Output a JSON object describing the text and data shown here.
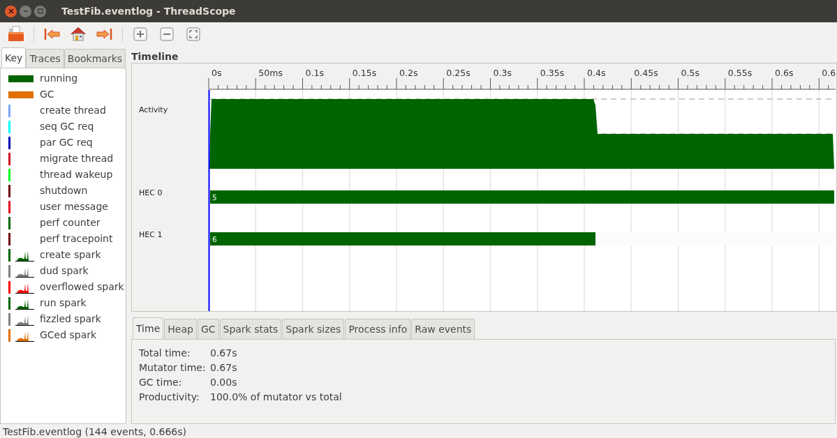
{
  "window": {
    "title": "TestFib.eventlog - ThreadScope"
  },
  "toolbar": [
    {
      "kind": "open"
    },
    {
      "kind": "first"
    },
    {
      "kind": "home"
    },
    {
      "kind": "last"
    },
    {
      "kind": "sep"
    },
    {
      "kind": "zoom-in"
    },
    {
      "kind": "zoom-out"
    },
    {
      "kind": "zoom-fit"
    }
  ],
  "side_tabs": [
    {
      "label": "Key",
      "selected": true
    },
    {
      "label": "Traces",
      "selected": false
    },
    {
      "label": "Bookmarks",
      "selected": false
    }
  ],
  "key": [
    {
      "label": "running",
      "kind": "bar",
      "color": "#006400"
    },
    {
      "label": "GC",
      "kind": "bar",
      "color": "#e07000"
    },
    {
      "label": "create thread",
      "kind": "line",
      "color": "#7aa7ff"
    },
    {
      "label": "seq GC req",
      "kind": "line",
      "color": "#00ffff"
    },
    {
      "label": "par GC req",
      "kind": "line",
      "color": "#0000b0"
    },
    {
      "label": "migrate thread",
      "kind": "line",
      "color": "#d0101c"
    },
    {
      "label": "thread wakeup",
      "kind": "line",
      "color": "#00ff20"
    },
    {
      "label": "shutdown",
      "kind": "line",
      "color": "#700010"
    },
    {
      "label": "user message",
      "kind": "line",
      "color": "#e01020"
    },
    {
      "label": "perf counter",
      "kind": "line",
      "color": "#006400"
    },
    {
      "label": "perf tracepoint",
      "kind": "line",
      "color": "#700010"
    },
    {
      "label": "create spark",
      "kind": "spark",
      "color": "#006400"
    },
    {
      "label": "dud spark",
      "kind": "spark",
      "color": "#808080"
    },
    {
      "label": "overflowed spark",
      "kind": "spark",
      "color": "#ff0000"
    },
    {
      "label": "run spark",
      "kind": "spark",
      "color": "#006400"
    },
    {
      "label": "fizzled spark",
      "kind": "spark",
      "color": "#808080"
    },
    {
      "label": "GCed spark",
      "kind": "spark",
      "color": "#e07000"
    }
  ],
  "timeline": {
    "title": "Timeline",
    "ticks": [
      "0s",
      "50ms",
      "0.1s",
      "0.15s",
      "0.2s",
      "0.25s",
      "0.3s",
      "0.35s",
      "0.4s",
      "0.45s",
      "0.5s",
      "0.55s",
      "0.6s",
      "0.6"
    ],
    "activity_label": "Activity",
    "hecs": [
      {
        "label": "HEC 0",
        "thread": "5",
        "level": 1.0
      },
      {
        "label": "HEC 1",
        "thread": "6",
        "level": 0.618
      }
    ]
  },
  "info_tabs": [
    {
      "label": "Time",
      "selected": true
    },
    {
      "label": "Heap",
      "selected": false
    },
    {
      "label": "GC",
      "selected": false
    },
    {
      "label": "Spark stats",
      "selected": false
    },
    {
      "label": "Spark sizes",
      "selected": false
    },
    {
      "label": "Process info",
      "selected": false
    },
    {
      "label": "Raw events",
      "selected": false
    }
  ],
  "stats": [
    {
      "label": "Total time:",
      "value": "0.67s"
    },
    {
      "label": "Mutator time:",
      "value": "0.67s"
    },
    {
      "label": "GC time:",
      "value": "0.00s"
    },
    {
      "label": "Productivity:",
      "value": "100.0% of mutator vs total"
    }
  ],
  "status_bar": "TestFib.eventlog (144 events, 0.666s)"
}
